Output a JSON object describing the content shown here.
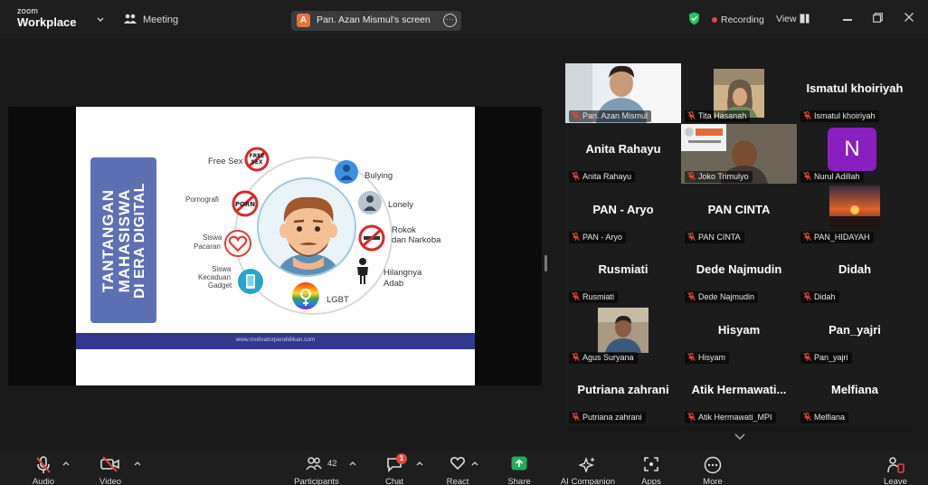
{
  "topbar": {
    "brand_line1": "zoom",
    "brand_line2": "Workplace",
    "meeting_label": "Meeting",
    "share_avatar": "A",
    "share_label": "Pan. Azan Mismul's screen",
    "recording_label": "Recording",
    "view_label": "View"
  },
  "slide": {
    "banner_line1": "TANTANGAN",
    "banner_line2": "MAHASISWA",
    "banner_line3": "DI ERA DIGITAL",
    "labels": {
      "free_sex": "Free Sex",
      "pornografi": "Pornografi",
      "siswa_pacaran_1": "Siswa",
      "siswa_pacaran_2": "Pacaran",
      "siswa_kecanduan_1": "Siswa",
      "siswa_kecanduan_2": "Kecaduan",
      "siswa_kecanduan_3": "Gadget",
      "bulying": "Bulying",
      "lonely": "Lonely",
      "rokok_1": "Rokok",
      "rokok_2": "dan Narkoba",
      "hilangnya_1": "Hilangnya",
      "hilangnya_2": "Adab",
      "lgbt": "LGBT",
      "free_badge": "FREE",
      "sex_badge": "SEX",
      "porn_badge": "PORN"
    },
    "footer_url": "www.motivatorpendidikan.com"
  },
  "gallery": {
    "tiles": [
      {
        "name": "",
        "label": "Pan. Azan Mismul",
        "video": true
      },
      {
        "name": "",
        "label": "Tita Hasanah",
        "video": true
      },
      {
        "name": "Ismatul khoiriyah",
        "label": "Ismatul khoiriyah",
        "video": false
      },
      {
        "name": "Anita Rahayu",
        "label": "Anita Rahayu",
        "video": false
      },
      {
        "name": "",
        "label": "Joko Trimulyo",
        "video": true
      },
      {
        "name": "",
        "label": "Nurul Adillah",
        "video": false,
        "avatar_letter": "N"
      },
      {
        "name": "PAN - Aryo",
        "label": "PAN - Aryo",
        "video": false
      },
      {
        "name": "PAN CINTA",
        "label": "PAN CINTA",
        "video": false
      },
      {
        "name": "",
        "label": "PAN_HIDAYAH",
        "video": false
      },
      {
        "name": "Rusmiati",
        "label": "Rusmiati",
        "video": false
      },
      {
        "name": "Dede Najmudin",
        "label": "Dede Najmudin",
        "video": false
      },
      {
        "name": "Didah",
        "label": "Didah",
        "video": false
      },
      {
        "name": "",
        "label": "Agus Suryana",
        "video": false
      },
      {
        "name": "Hisyam",
        "label": "Hisyam",
        "video": false
      },
      {
        "name": "Pan_yajri",
        "label": "Pan_yajri",
        "video": false
      },
      {
        "name": "Putriana zahrani",
        "label": "Putriana zahrani",
        "video": false
      },
      {
        "name": "Atik Hermawati...",
        "label": "Atik Hermawati_MPI",
        "video": false
      },
      {
        "name": "Melfiana",
        "label": "Melfiana",
        "video": false
      }
    ]
  },
  "toolbar": {
    "audio": "Audio",
    "video": "Video",
    "participants": "Participants",
    "participants_count": "42",
    "chat": "Chat",
    "chat_badge": "1",
    "react": "React",
    "share": "Share",
    "ai_companion": "AI Companion",
    "apps": "Apps",
    "more": "More",
    "leave": "Leave"
  },
  "colors": {
    "background": "#1a1a1a",
    "banner": "#5b71b3",
    "footer": "#33388f",
    "recording": "#e5483e",
    "shield": "#23c55e",
    "share_green": "#1fae5b",
    "active_speaker": "#3ad36a",
    "avatar_purple": "#8a1fbf"
  }
}
